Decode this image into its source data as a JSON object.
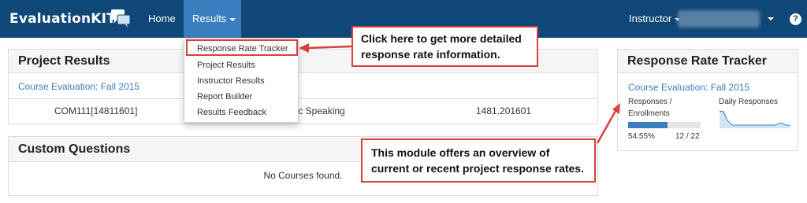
{
  "navbar": {
    "brand": "EvaluationKIT",
    "home": "Home",
    "results": "Results",
    "instructor": "Instructor",
    "help": "?"
  },
  "dropdown": {
    "items": [
      "Response Rate Tracker",
      "Project Results",
      "Instructor Results",
      "Report Builder",
      "Results Feedback"
    ]
  },
  "project_results": {
    "title": "Project Results",
    "link": "Course Evaluation: Fall 2015",
    "course_code": "COM111[14811601]",
    "course_name": "lic Speaking",
    "section": "1481.201601"
  },
  "custom_questions": {
    "title": "Custom Questions",
    "empty": "No Courses found."
  },
  "response_rate_tracker": {
    "title": "Response Rate Tracker",
    "link": "Course Evaluation: Fall 2015",
    "responses_label_1": "Responses /",
    "responses_label_2": "Enrollments",
    "daily_label": "Daily Responses",
    "percent": "54.55%",
    "count": "12 / 22",
    "progress_fraction": 0.5455
  },
  "callouts": {
    "first_line1": "Click here to get more detailed",
    "first_line2": "response rate information.",
    "second_line1": "This module offers an overview of",
    "second_line2": "current or recent project response rates."
  },
  "colors": {
    "navbar": "#0f4779",
    "active_tab": "#3a7ec0",
    "callout_border": "#d8423a",
    "link": "#3a7ec0"
  }
}
